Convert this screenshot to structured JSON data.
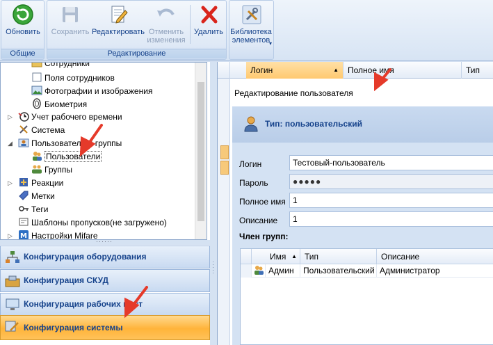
{
  "ribbon": {
    "groups": [
      {
        "caption": "Общие",
        "buttons": [
          {
            "label": "Обновить",
            "icon": "refresh-icon",
            "enabled": true
          }
        ]
      },
      {
        "caption": "Редактирование",
        "buttons": [
          {
            "label": "Сохранить",
            "icon": "save-icon",
            "enabled": false
          },
          {
            "label": "Редактировать",
            "icon": "edit-icon",
            "enabled": true
          },
          {
            "label": "Отменить изменения",
            "icon": "undo-icon",
            "enabled": false
          },
          {
            "label": "Удалить",
            "icon": "delete-icon",
            "enabled": true
          }
        ]
      },
      {
        "caption": "",
        "buttons": [
          {
            "label": "Библиотека элементов",
            "icon": "tools-icon",
            "enabled": true,
            "dropdown": true
          }
        ]
      }
    ]
  },
  "tree": {
    "items": [
      {
        "label": "Сотрудники",
        "icon": "folder-icon"
      },
      {
        "label": "Поля сотрудников",
        "icon": "field-icon"
      },
      {
        "label": "Фотографии и изображения",
        "icon": "photo-icon"
      },
      {
        "label": "Биометрия",
        "icon": "fingerprint-icon"
      },
      {
        "label": "Учет рабочего времени",
        "icon": "clock-icon"
      },
      {
        "label": "Система",
        "icon": "tools-icon"
      },
      {
        "label": "Пользователи и группы",
        "icon": "users-folder-icon"
      },
      {
        "label": "Пользователи",
        "icon": "user-icon",
        "selected": true
      },
      {
        "label": "Группы",
        "icon": "group-icon"
      },
      {
        "label": "Реакции",
        "icon": "reaction-icon"
      },
      {
        "label": "Метки",
        "icon": "tag-icon"
      },
      {
        "label": "Теги",
        "icon": "key-icon"
      },
      {
        "label": "Шаблоны пропусков(не загружено)",
        "icon": "template-icon"
      },
      {
        "label": "Настройки Mifare",
        "icon": "mifare-icon"
      }
    ]
  },
  "nav": {
    "items": [
      {
        "label": "Конфигурация оборудования",
        "icon": "network-icon",
        "active": false
      },
      {
        "label": "Конфигурация СКУД",
        "icon": "access-control-icon",
        "active": false
      },
      {
        "label": "Конфигурация рабочих мест",
        "icon": "workstation-icon",
        "active": false
      },
      {
        "label": "Конфигурация системы",
        "icon": "system-icon",
        "active": true
      }
    ]
  },
  "grid": {
    "columns": [
      "Логин",
      "Полное имя",
      "Тип"
    ]
  },
  "editor": {
    "title": "Редактирование пользователя",
    "type_label": "Тип: пользовательский",
    "fields": {
      "login_label": "Логин",
      "login_value": "Тестовый-пользователь",
      "password_label": "Пароль",
      "password_value": "●●●●●",
      "fullname_label": "Полное имя",
      "fullname_value": "1",
      "description_label": "Описание",
      "description_value": "1"
    },
    "members": {
      "title": "Член групп:",
      "columns": [
        "Имя",
        "Тип",
        "Описание"
      ],
      "rows": [
        {
          "name": "Админ",
          "type": "Пользовательский",
          "description": "Администратор"
        }
      ]
    }
  },
  "colors": {
    "accent": "#15428b",
    "active_nav": "#ffb43a",
    "annotation": "#e53a2a"
  }
}
